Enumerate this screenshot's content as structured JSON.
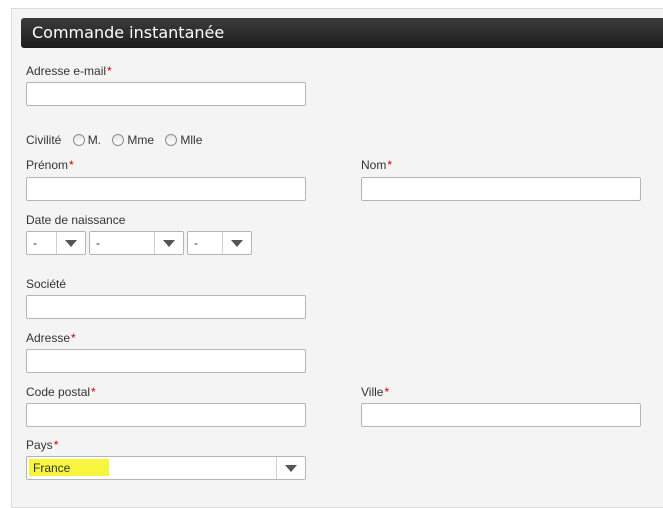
{
  "header": {
    "title": "Commande instantanée"
  },
  "form": {
    "email_label": "Adresse e-mail",
    "civility_label": "Civilité",
    "civility_options": [
      "M.",
      "Mme",
      "Mlle"
    ],
    "firstname_label": "Prénom",
    "lastname_label": "Nom",
    "birthdate_label": "Date de naissance",
    "birth_day_value": "-",
    "birth_month_value": "-",
    "birth_year_value": "-",
    "company_label": "Société",
    "address_label": "Adresse",
    "postcode_label": "Code postal",
    "city_label": "Ville",
    "country_label": "Pays",
    "country_value": "France",
    "required_marker": "*"
  },
  "colors": {
    "header_bg": "#2b2b2b",
    "required": "#cc0000",
    "highlight": "#f8f53e"
  }
}
